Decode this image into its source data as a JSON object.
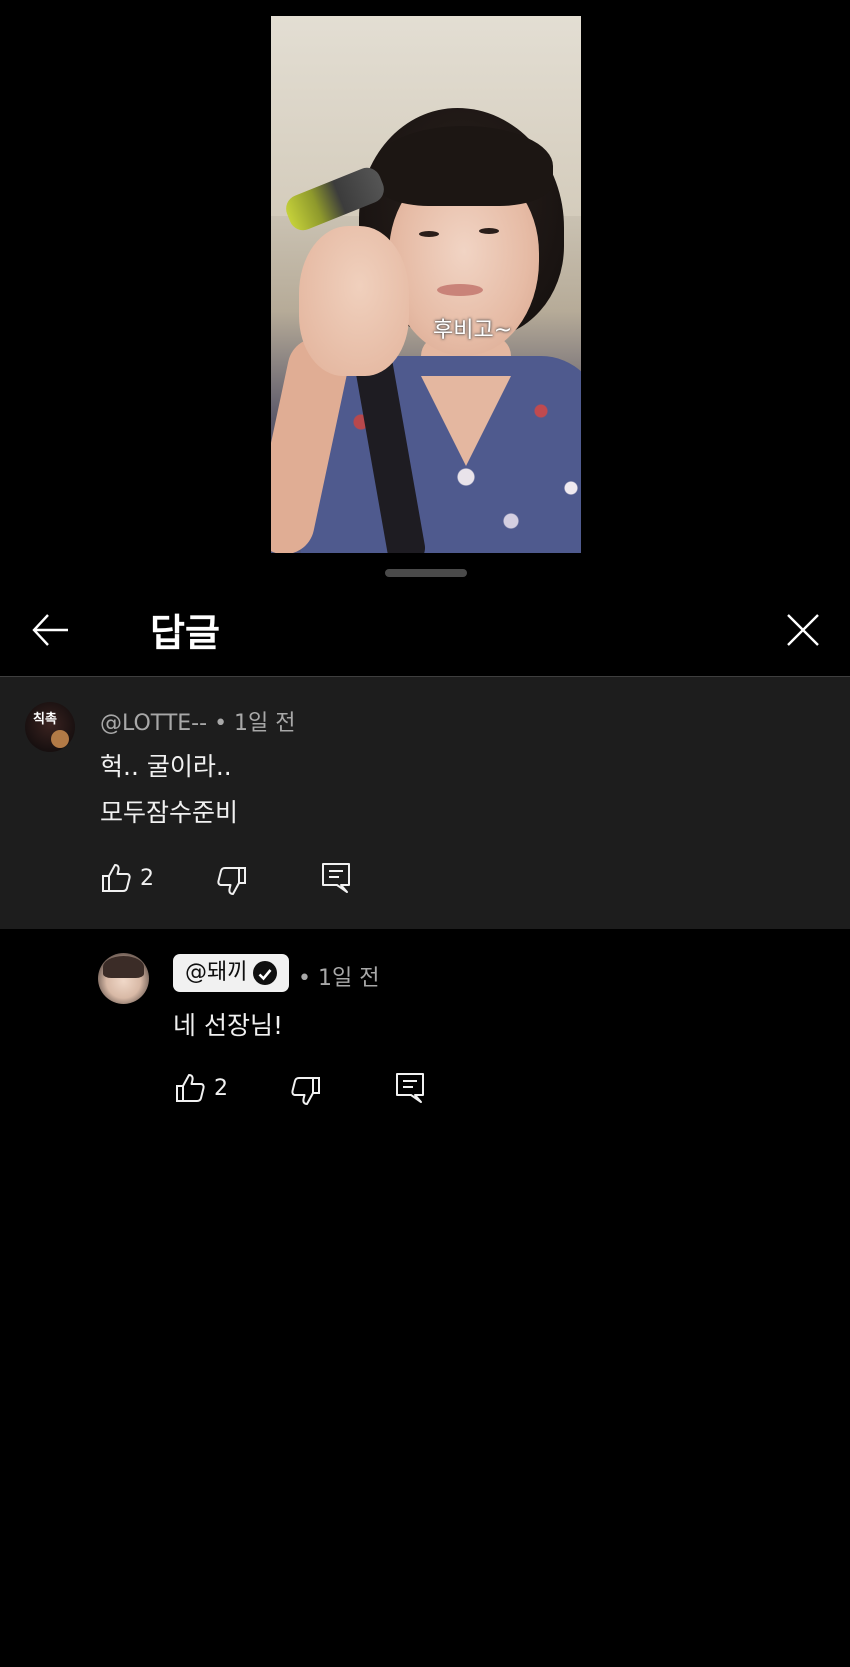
{
  "video": {
    "caption": "후비고~"
  },
  "header": {
    "title": "답글"
  },
  "parent_comment": {
    "author": "@LOTTE--",
    "separator": "•",
    "time": "1일 전",
    "lines": [
      "헉..  굴이라..",
      "모두잠수준비"
    ],
    "like_count": "2",
    "avatar_text": "칙촉"
  },
  "reply": {
    "author": "@돼끼",
    "separator": "•",
    "time": "1일 전",
    "text": "네 선장님!",
    "like_count": "2"
  },
  "colors": {
    "background": "#000000",
    "parent_block": "#1d1d1d",
    "meta_text": "#a8a8a8",
    "text": "#f1f1f1",
    "chip": "#f1f1f1"
  }
}
